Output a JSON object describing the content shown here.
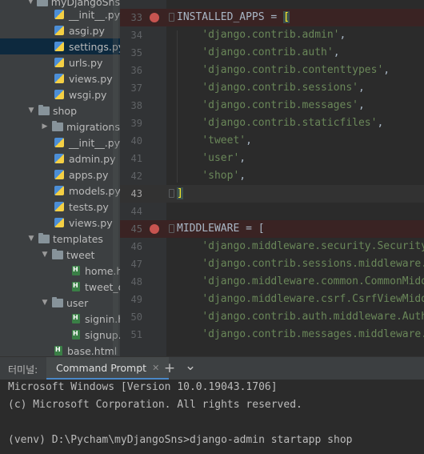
{
  "project_tree": {
    "top_folder_partial": "myDjangoSns",
    "items": [
      {
        "label": "__init__.py",
        "type": "py"
      },
      {
        "label": "asgi.py",
        "type": "py"
      },
      {
        "label": "settings.py",
        "type": "py",
        "selected": true
      },
      {
        "label": "urls.py",
        "type": "py"
      },
      {
        "label": "views.py",
        "type": "py"
      },
      {
        "label": "wsgi.py",
        "type": "py"
      },
      {
        "label": "shop",
        "type": "folder",
        "expanded": true
      },
      {
        "label": "migrations",
        "type": "folder",
        "expanded": false
      },
      {
        "label": "__init__.py",
        "type": "py"
      },
      {
        "label": "admin.py",
        "type": "py"
      },
      {
        "label": "apps.py",
        "type": "py"
      },
      {
        "label": "models.py",
        "type": "py"
      },
      {
        "label": "tests.py",
        "type": "py"
      },
      {
        "label": "views.py",
        "type": "py"
      },
      {
        "label": "templates",
        "type": "folder",
        "expanded": true
      },
      {
        "label": "tweet",
        "type": "folder",
        "expanded": true
      },
      {
        "label": "home.html",
        "type": "html"
      },
      {
        "label": "tweet_detail.html",
        "type": "html"
      },
      {
        "label": "user",
        "type": "folder",
        "expanded": true
      },
      {
        "label": "signin.html",
        "type": "html"
      },
      {
        "label": "signup.html",
        "type": "html"
      },
      {
        "label": "base.html",
        "type": "html"
      }
    ]
  },
  "editor": {
    "lines": [
      {
        "num": "33",
        "text": "INSTALLED_APPS = [",
        "breakpoint": true
      },
      {
        "num": "34",
        "text": "    'django.contrib.admin',"
      },
      {
        "num": "35",
        "text": "    'django.contrib.auth',"
      },
      {
        "num": "36",
        "text": "    'django.contrib.contenttypes',"
      },
      {
        "num": "37",
        "text": "    'django.contrib.sessions',"
      },
      {
        "num": "38",
        "text": "    'django.contrib.messages',"
      },
      {
        "num": "39",
        "text": "    'django.contrib.staticfiles',"
      },
      {
        "num": "40",
        "text": "    'tweet',"
      },
      {
        "num": "41",
        "text": "    'user',"
      },
      {
        "num": "42",
        "text": "    'shop',"
      },
      {
        "num": "43",
        "text": "]",
        "current": true
      },
      {
        "num": "44",
        "text": ""
      },
      {
        "num": "45",
        "text": "MIDDLEWARE = [",
        "breakpoint": true
      },
      {
        "num": "46",
        "text": "    'django.middleware.security.SecurityMiddleware',"
      },
      {
        "num": "47",
        "text": "    'django.contrib.sessions.middleware.SessionMiddleware',"
      },
      {
        "num": "48",
        "text": "    'django.middleware.common.CommonMiddleware',"
      },
      {
        "num": "49",
        "text": "    'django.middleware.csrf.CsrfViewMiddleware',"
      },
      {
        "num": "50",
        "text": "    'django.contrib.auth.middleware.AuthenticationMiddleware',"
      },
      {
        "num": "51",
        "text": "    'django.contrib.messages.middleware.MessageMiddleware',"
      }
    ]
  },
  "terminal": {
    "panel_label": "터미널:",
    "tab_label": "Command Prompt",
    "tab_close": "✕",
    "add_button": "+",
    "dropdown_button": "⌄",
    "lines": [
      "Microsoft Windows [Version 10.0.19043.1706]",
      "(c) Microsoft Corporation. All rights reserved.",
      "",
      "(venv) D:\\Pycham\\myDjangoSns>django-admin startapp shop"
    ]
  },
  "colors": {
    "breakpoint": "#c75450",
    "string": "#6a8759",
    "selection": "#0d293e",
    "tab_accent": "#4a88c7"
  }
}
